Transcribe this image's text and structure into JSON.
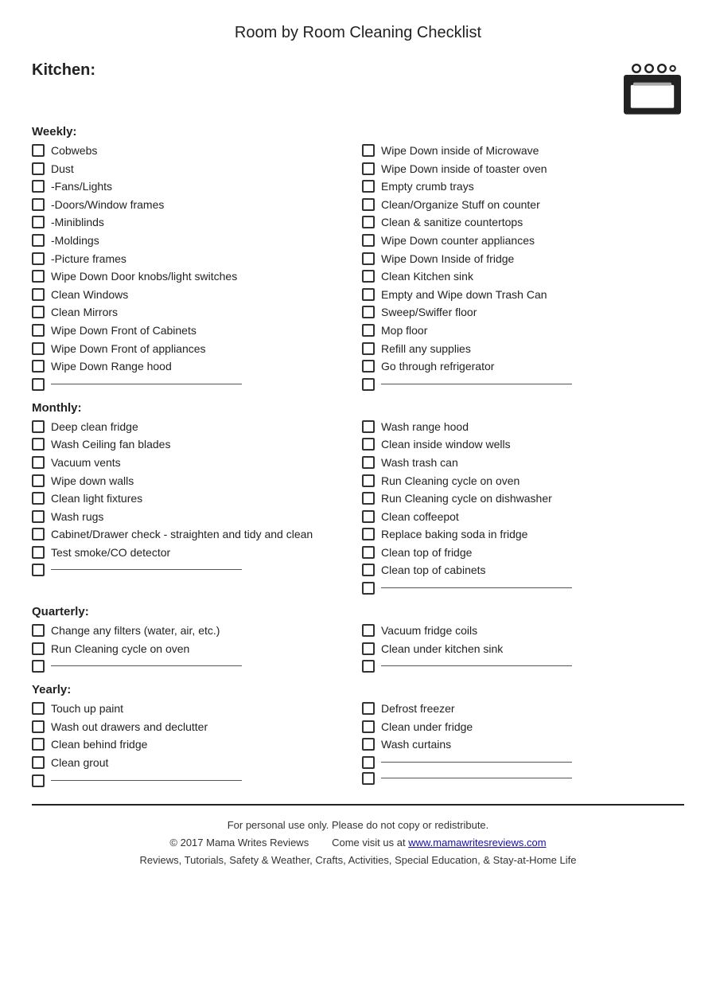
{
  "title": "Room by Room Cleaning Checklist",
  "room": "Kitchen:",
  "sections": {
    "weekly": {
      "label": "Weekly:",
      "left": [
        "Cobwebs",
        "Dust",
        "-Fans/Lights",
        "-Doors/Window frames",
        "-Miniblinds",
        "-Moldings",
        "-Picture frames",
        "Wipe Down Door knobs/light switches",
        "Clean Windows",
        "Clean Mirrors",
        "Wipe Down Front of Cabinets",
        "Wipe Down Front of appliances",
        "Wipe Down Range hood"
      ],
      "right": [
        "Wipe Down inside of Microwave",
        "Wipe Down inside of toaster oven",
        "Empty crumb trays",
        "Clean/Organize Stuff on counter",
        "Clean & sanitize countertops",
        "Wipe Down counter appliances",
        "Wipe Down Inside of fridge",
        "Clean Kitchen sink",
        "Empty and Wipe down Trash Can",
        "Sweep/Swiffer floor",
        "Mop floor",
        "Refill any supplies",
        "Go through refrigerator"
      ]
    },
    "monthly": {
      "label": "Monthly:",
      "left": [
        "Deep clean fridge",
        "Wash Ceiling fan blades",
        "Vacuum vents",
        "Wipe down walls",
        "Clean light fixtures",
        "Wash rugs",
        "Cabinet/Drawer check - straighten and tidy and clean",
        "Test smoke/CO detector"
      ],
      "right": [
        "Wash range hood",
        "Clean inside window wells",
        "Wash trash can",
        "Run Cleaning cycle on oven",
        "Run Cleaning cycle on dishwasher",
        "Clean coffeepot",
        "Replace baking soda in fridge",
        "Clean top of fridge",
        "Clean top of cabinets"
      ]
    },
    "quarterly": {
      "label": "Quarterly:",
      "left": [
        "Change any filters (water, air, etc.)",
        "Run Cleaning cycle on oven"
      ],
      "right": [
        "Vacuum fridge coils",
        "Clean under kitchen sink"
      ]
    },
    "yearly": {
      "label": "Yearly:",
      "left": [
        "Touch up paint",
        "Wash out drawers and declutter",
        "Clean behind fridge",
        "Clean grout"
      ],
      "right": [
        "Defrost freezer",
        "Clean under fridge",
        "Wash curtains"
      ]
    }
  },
  "footer": {
    "line1": "For personal use only. Please do not copy or redistribute.",
    "line2_left": "© 2017 Mama Writes Reviews",
    "line2_right": "Come visit us at ",
    "link_text": "www.mamawritesreviews.com",
    "link_url": "#",
    "line3": "Reviews, Tutorials, Safety & Weather, Crafts, Activities, Special Education, & Stay-at-Home Life"
  }
}
